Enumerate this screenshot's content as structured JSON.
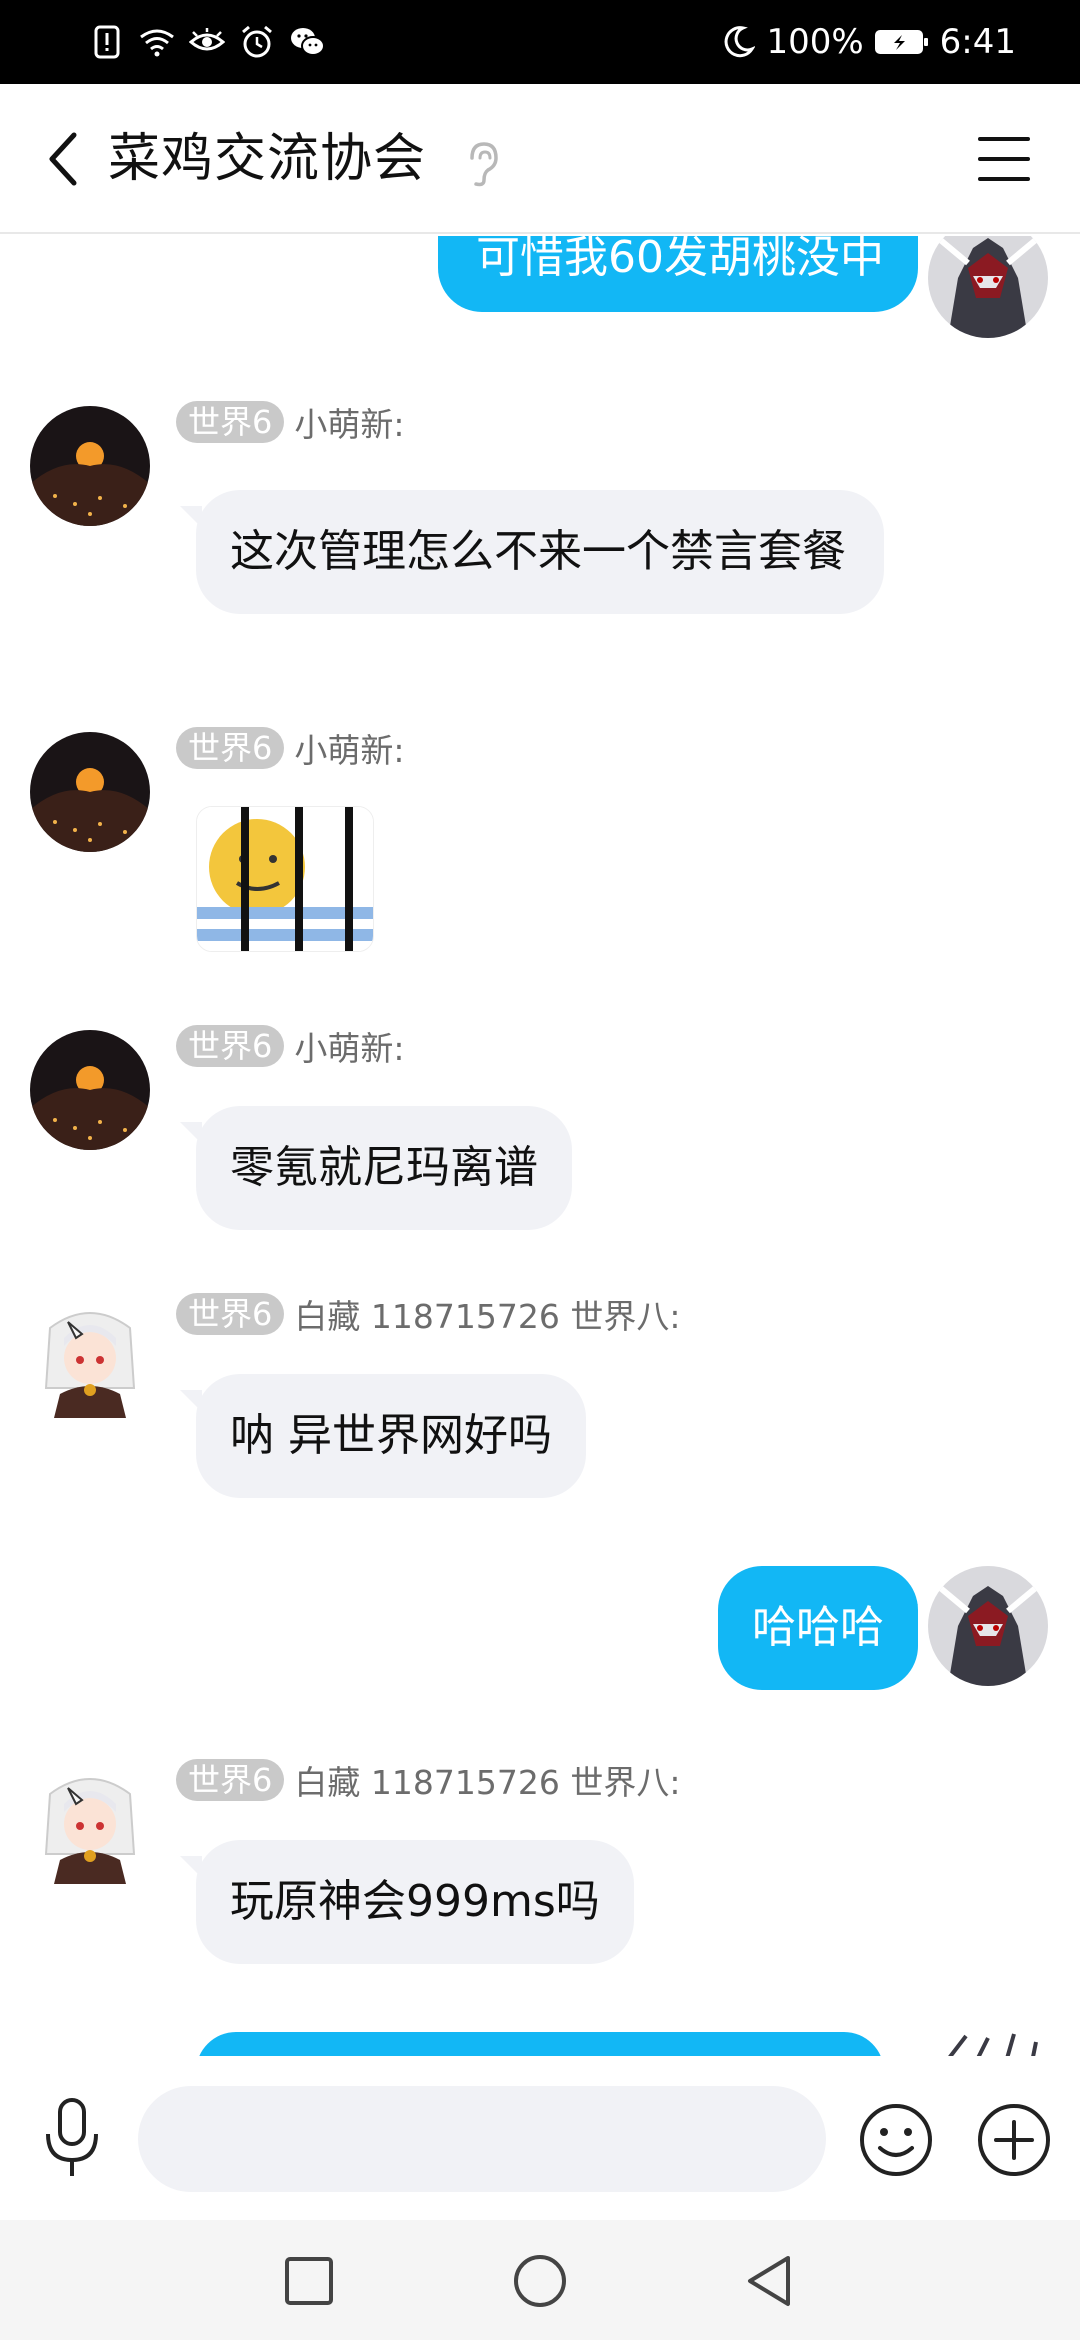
{
  "status_bar": {
    "battery_percent": "100%",
    "time": "6:41",
    "icons": [
      "alert-icon",
      "wifi-icon",
      "eye-icon",
      "alarm-icon",
      "wechat-icon",
      "moon-icon",
      "battery-icon"
    ]
  },
  "header": {
    "title": "菜鸡交流协会"
  },
  "messages": [
    {
      "side": "out",
      "text": "可惜我60发胡桃没中"
    },
    {
      "side": "in",
      "badge": "世界6",
      "sender": "小萌新:",
      "text": "这次管理怎么不来一个禁言套餐"
    },
    {
      "side": "in",
      "badge": "世界6",
      "sender": "小萌新:",
      "sticker": "jail-sticker"
    },
    {
      "side": "in",
      "badge": "世界6",
      "sender": "小萌新:",
      "text": "零氪就尼玛离谱"
    },
    {
      "side": "in",
      "badge": "世界6",
      "sender": "白藏 118715726 世界八:",
      "text": "呐 异世界网好吗"
    },
    {
      "side": "out",
      "text": "哈哈哈"
    },
    {
      "side": "in",
      "badge": "世界6",
      "sender": "白藏 118715726 世界八:",
      "text": "玩原神会999ms吗"
    }
  ],
  "input": {
    "value": "",
    "placeholder": ""
  },
  "colors": {
    "accent": "#12b7f5",
    "incoming_bubble": "#f1f2f6",
    "badge": "#c9c9c9"
  }
}
